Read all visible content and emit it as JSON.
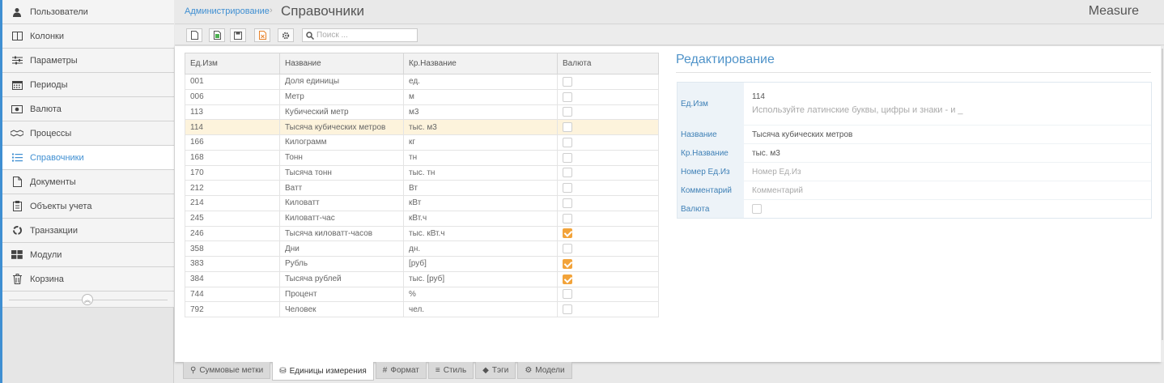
{
  "sidebar": {
    "items": [
      {
        "label": "Пользователи",
        "icon": "user-icon"
      },
      {
        "label": "Колонки",
        "icon": "columns-icon"
      },
      {
        "label": "Параметры",
        "icon": "sliders-icon"
      },
      {
        "label": "Периоды",
        "icon": "calendar-icon"
      },
      {
        "label": "Валюта",
        "icon": "money-icon"
      },
      {
        "label": "Процессы",
        "icon": "handshake-icon"
      },
      {
        "label": "Справочники",
        "icon": "list-icon",
        "active": true
      },
      {
        "label": "Документы",
        "icon": "document-icon"
      },
      {
        "label": "Объекты учета",
        "icon": "clipboard-icon"
      },
      {
        "label": "Транзакции",
        "icon": "recycle-icon"
      },
      {
        "label": "Модули",
        "icon": "modules-icon"
      },
      {
        "label": "Корзина",
        "icon": "trash-icon"
      }
    ],
    "collapse_icon": "chevron-up-icon"
  },
  "header": {
    "breadcrumb": "Администрирование",
    "separator": "›",
    "title": "Справочники",
    "app_name": "Measure"
  },
  "toolbar": {
    "search_placeholder": "Поиск ...",
    "buttons": [
      "new-icon",
      "add-icon",
      "save-icon",
      "delete-icon",
      "settings-icon"
    ]
  },
  "table": {
    "columns": [
      "Ед.Изм",
      "Название",
      "Кр.Название",
      "Валюта"
    ],
    "rows": [
      {
        "code": "001",
        "name": "Доля единицы",
        "short": "ед.",
        "currency": false
      },
      {
        "code": "006",
        "name": "Метр",
        "short": "м",
        "currency": false
      },
      {
        "code": "113",
        "name": "Кубический метр",
        "short": "м3",
        "currency": false
      },
      {
        "code": "114",
        "name": "Тысяча кубических метров",
        "short": "тыс. м3",
        "currency": false,
        "selected": true
      },
      {
        "code": "166",
        "name": "Килограмм",
        "short": "кг",
        "currency": false
      },
      {
        "code": "168",
        "name": "Тонн",
        "short": "тн",
        "currency": false
      },
      {
        "code": "170",
        "name": "Тысяча тонн",
        "short": "тыс. тн",
        "currency": false
      },
      {
        "code": "212",
        "name": "Ватт",
        "short": "Вт",
        "currency": false
      },
      {
        "code": "214",
        "name": "Киловатт",
        "short": "кВт",
        "currency": false
      },
      {
        "code": "245",
        "name": "Киловатт-час",
        "short": "кВт.ч",
        "currency": false
      },
      {
        "code": "246",
        "name": "Тысяча киловатт-часов",
        "short": "тыс. кВт.ч",
        "currency": true
      },
      {
        "code": "358",
        "name": "Дни",
        "short": "дн.",
        "currency": false
      },
      {
        "code": "383",
        "name": "Рубль",
        "short": "[руб]",
        "currency": true
      },
      {
        "code": "384",
        "name": "Тысяча рублей",
        "short": "тыс. [руб]",
        "currency": true
      },
      {
        "code": "744",
        "name": "Процент",
        "short": "%",
        "currency": false
      },
      {
        "code": "792",
        "name": "Человек",
        "short": "чел.",
        "currency": false
      }
    ]
  },
  "edit": {
    "title": "Редактирование",
    "fields": {
      "unit": {
        "label": "Ед.Изм",
        "value": "114",
        "hint": "Используйте латинские буквы, цифры и знаки - и _"
      },
      "name": {
        "label": "Название",
        "value": "Тысяча кубических метров"
      },
      "short": {
        "label": "Кр.Название",
        "value": "тыс. м3"
      },
      "number": {
        "label": "Номер Ед.Из",
        "placeholder": "Номер Ед.Из"
      },
      "comment": {
        "label": "Комментарий",
        "placeholder": "Комментарий"
      },
      "currency": {
        "label": "Валюта",
        "checked": false
      }
    }
  },
  "bottom_tabs": [
    {
      "label": "Суммовые метки",
      "icon": "pin-icon"
    },
    {
      "label": "Единицы измерения",
      "icon": "cubes-icon",
      "active": true
    },
    {
      "label": "Формат",
      "icon": "hash-icon"
    },
    {
      "label": "Стиль",
      "icon": "style-icon"
    },
    {
      "label": "Тэги",
      "icon": "tag-icon"
    },
    {
      "label": "Модели",
      "icon": "models-icon"
    }
  ],
  "colors": {
    "accent": "#3f8fd2",
    "checkbox_on": "#f2a33a",
    "selected_row": "#fdf3dc"
  }
}
